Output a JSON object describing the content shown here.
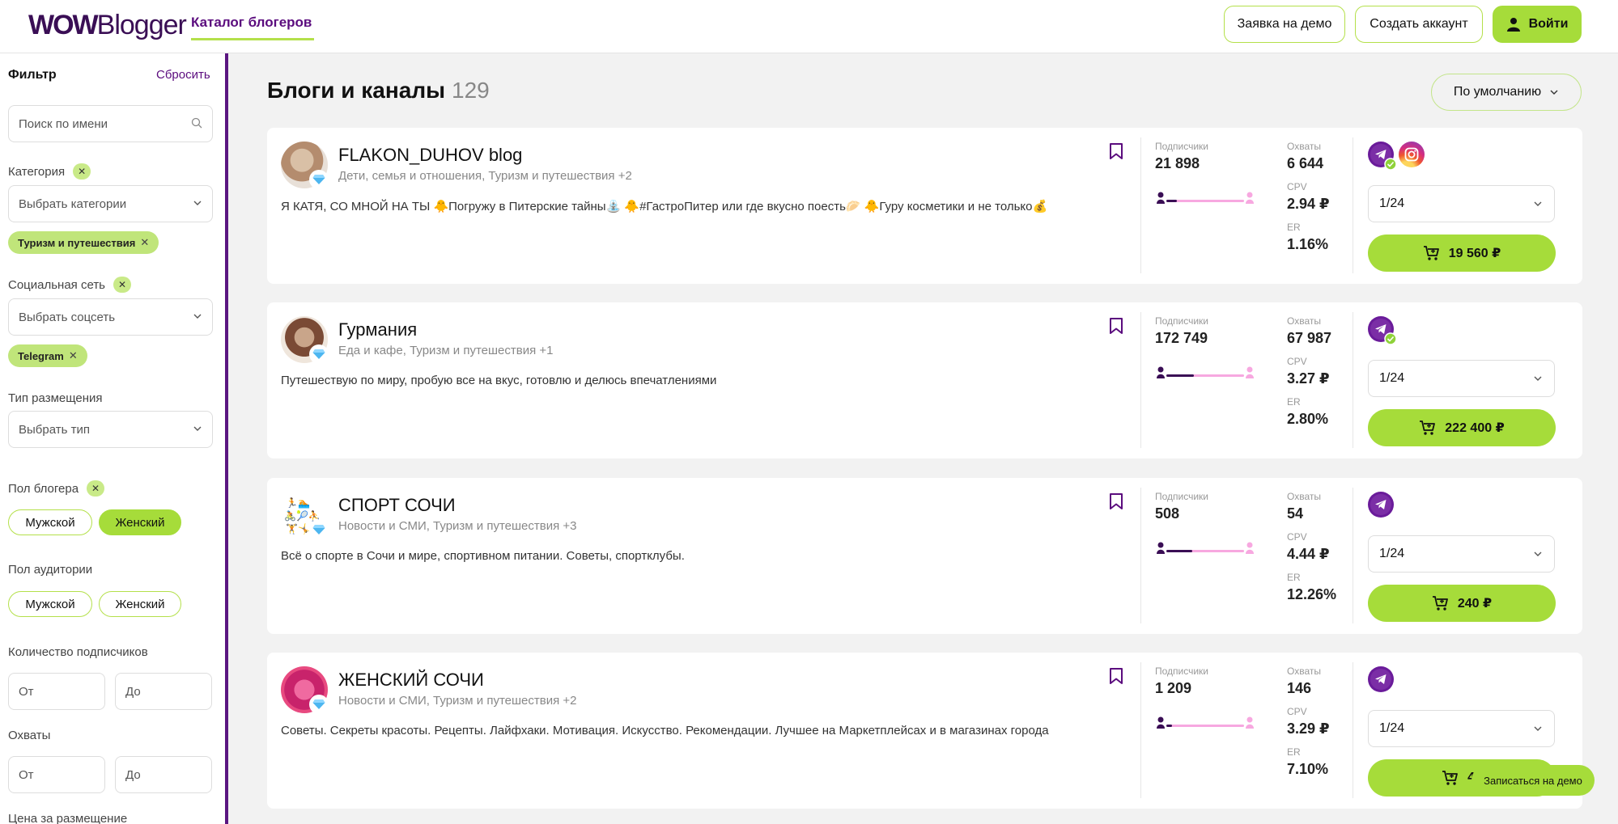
{
  "header": {
    "logo_bold": "WOW",
    "logo_regular": "Blogger",
    "nav_catalog": "Каталог блогеров",
    "demo_button": "Заявка на демо",
    "create_button": "Создать аккаунт",
    "login_button": "Войти"
  },
  "sidebar": {
    "title": "Фильтр",
    "reset": "Сбросить",
    "search_placeholder": "Поиск по имени",
    "category_label": "Категория",
    "category_select": "Выбрать категории",
    "category_chip": "Туризм и путешествия",
    "social_label": "Социальная сеть",
    "social_select": "Выбрать соцсеть",
    "social_chip": "Telegram",
    "placement_label": "Тип размещения",
    "placement_select": "Выбрать тип",
    "blogger_gender_label": "Пол блогера",
    "blogger_gender_options": [
      "Мужской",
      "Женский"
    ],
    "audience_gender_label": "Пол аудитории",
    "audience_gender_options": [
      "Мужской",
      "Женский"
    ],
    "subscribers_label": "Количество подписчиков",
    "reach_label": "Охваты",
    "from": "От",
    "to": "До",
    "price_label": "Цена за размещение"
  },
  "main": {
    "title": "Блоги и каналы",
    "count": "129",
    "sort": "По умолчанию",
    "stat_labels": {
      "subscribers": "Подписчики",
      "reach": "Охваты",
      "cpv": "CPV",
      "er": "ER"
    },
    "cards": [
      {
        "name": "FLAKON_DUHOV blog",
        "categories": "Дети, семья и отношения,  Туризм и путешествия   +2",
        "description": "Я КАТЯ, СО МНОЙ НА ТЫ 🐥Погружу в Питерские тайны⛲️ 🐥#ГастроПитер или где вкусно поесть🥟 🐥Гуру косметики и не только💰",
        "subscribers": "21 898",
        "reach": "6 644",
        "cpv": "2.94 ₽",
        "er": "1.16%",
        "male_share": 0.14,
        "networks": [
          "telegram",
          "instagram"
        ],
        "format": "1/24",
        "price": "19 560 ₽"
      },
      {
        "name": "Гурмания",
        "categories": "Еда и кафе,  Туризм и путешествия   +1",
        "description": "Путешествую по миру, пробую все на вкус, готовлю и делюсь впечатлениями",
        "subscribers": "172 749",
        "reach": "67 987",
        "cpv": "3.27 ₽",
        "er": "2.80%",
        "male_share": 0.35,
        "networks": [
          "telegram"
        ],
        "format": "1/24",
        "price": "222 400 ₽"
      },
      {
        "name": "СПОРТ СОЧИ",
        "categories": "Новости и СМИ,  Туризм и путешествия   +3",
        "description": "Всё о спорте в Сочи и мире, спортивном питании. Советы, спортклубы.",
        "subscribers": "508",
        "reach": "54",
        "cpv": "4.44 ₽",
        "er": "12.26%",
        "male_share": 0.33,
        "networks": [
          "telegram"
        ],
        "format": "1/24",
        "price": "240 ₽"
      },
      {
        "name": "ЖЕНСКИЙ СОЧИ",
        "categories": "Новости и СМИ,  Туризм и путешествия   +2",
        "description": "Советы. Секреты красоты. Рецепты. Лайфхаки. Мотивация. Искусство. Рекомендации. Лучшее на Маркетплейсах и в магазинах города",
        "subscribers": "1 209",
        "reach": "146",
        "cpv": "3.29 ₽",
        "er": "7.10%",
        "male_share": 0.07,
        "networks": [
          "telegram"
        ],
        "format": "1/24",
        "price": "48"
      }
    ]
  },
  "floating": {
    "demo": "Записаться на демо"
  },
  "colors": {
    "accent_green": "#a6dc3a",
    "brand_purple": "#5b0c7e",
    "telegram_purple": "#6a1b9a",
    "bar_pink": "#f7a8e0"
  }
}
